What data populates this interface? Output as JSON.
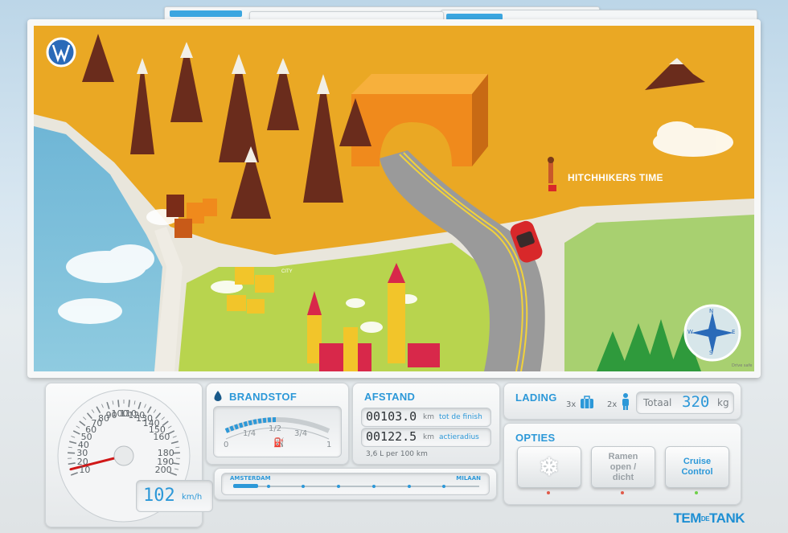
{
  "map": {
    "location_label": "HITCHHIKERS TIME",
    "city_label": "CITY",
    "footer_note": "Drive safe",
    "compass_letters": [
      "N",
      "E",
      "S",
      "W"
    ]
  },
  "speedometer": {
    "tick_labels": [
      "10",
      "20",
      "30",
      "40",
      "50",
      "60",
      "70",
      "80",
      "90",
      "100",
      "110",
      "120",
      "130",
      "140",
      "150",
      "160",
      "170",
      "180",
      "190",
      "200"
    ],
    "speed_value": "102",
    "speed_unit": "km/h",
    "needle_value": 15
  },
  "fuel": {
    "title": "BRANDSTOF",
    "gauge_labels": [
      "0",
      "1/4",
      "1/2",
      "3/4",
      "1"
    ],
    "level_fraction": 0.5
  },
  "distance": {
    "title": "AFSTAND",
    "finish_value": "00103.0",
    "finish_unit": "km",
    "finish_label": "tot de finish",
    "range_value": "00122.5",
    "range_unit": "km",
    "range_label": "actieradius",
    "consumption": "3,6 L per 100 km"
  },
  "route": {
    "start_label": "AMSTERDAM",
    "end_label": "MILAAN",
    "progress_fraction": 0.1,
    "stops": 6
  },
  "lading": {
    "title": "LADING",
    "luggage_count": "3x",
    "person_count": "2x",
    "total_label": "Totaal",
    "total_value": "320",
    "total_unit": "kg"
  },
  "opties": {
    "title": "OPTIES",
    "windows_label": "Ramen open / dicht",
    "cruise_label": "Cruise Control",
    "led_colors": [
      "#e05a4a",
      "#e05a4a",
      "#6fd04a"
    ]
  },
  "brand": {
    "logo_main_1": "TEM",
    "logo_small": "DE",
    "logo_main_2": "TANK",
    "vw": "VW"
  },
  "colors": {
    "accent": "#2c98d8",
    "mountain_yellow": "#eaa824",
    "mountain_brown": "#6a2c1c",
    "grass": "#b8d44e",
    "road": "#9a9a9a",
    "water": "#7dbfd8"
  }
}
